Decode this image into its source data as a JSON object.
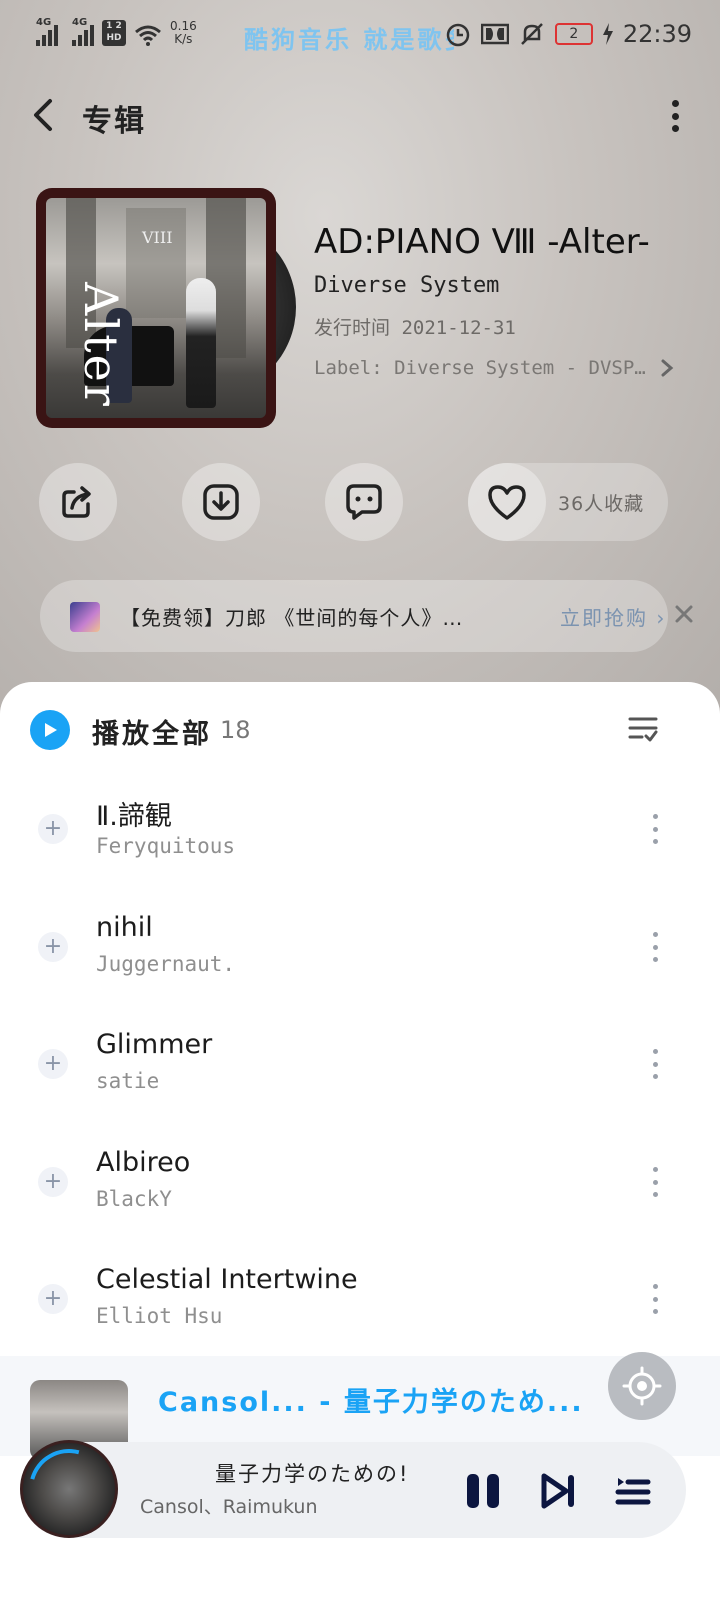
{
  "status_bar": {
    "network_1": "4G",
    "network_2": "4G",
    "hd_badge": "HD",
    "net_speed_value": "0.16",
    "net_speed_unit": "K/s",
    "marquee": "酷狗音乐 就是歌多",
    "battery": "2",
    "time": "22:39"
  },
  "header": {
    "title": "专辑"
  },
  "album": {
    "cover_text": "Alter",
    "cover_number": "VIII",
    "title": "AD:PIANO Ⅷ -Alter-",
    "artist": "Diverse System",
    "release": "发行时间 2021-12-31",
    "label": "Label: Diverse System - DVSP…"
  },
  "actions": {
    "share_icon": "share-icon",
    "download_icon": "download-icon",
    "comment_icon": "comment-icon",
    "favorite_icon": "heart-icon",
    "favorite_count": "36人收藏"
  },
  "promo": {
    "text": "【免费领】刀郎 《世间的每个人》…",
    "cta": "立即抢购"
  },
  "playlist": {
    "play_all_label": "播放全部",
    "count": "18",
    "songs": [
      {
        "title": "Ⅱ.諦観",
        "artist": "Feryquitous"
      },
      {
        "title": "nihil",
        "artist": "Juggernaut."
      },
      {
        "title": "Glimmer",
        "artist": "satie"
      },
      {
        "title": "Albireo",
        "artist": "BlackY"
      },
      {
        "title": "Celestial Intertwine",
        "artist": "Elliot Hsu"
      }
    ]
  },
  "now_playing": {
    "lyric_line": "Cansol... - 量子力学のため...",
    "title": "量子力学のための!",
    "artist": "Cansol、Raimukun"
  },
  "colors": {
    "accent": "#1aa3f5",
    "banner_cta": "#7b93b0"
  }
}
